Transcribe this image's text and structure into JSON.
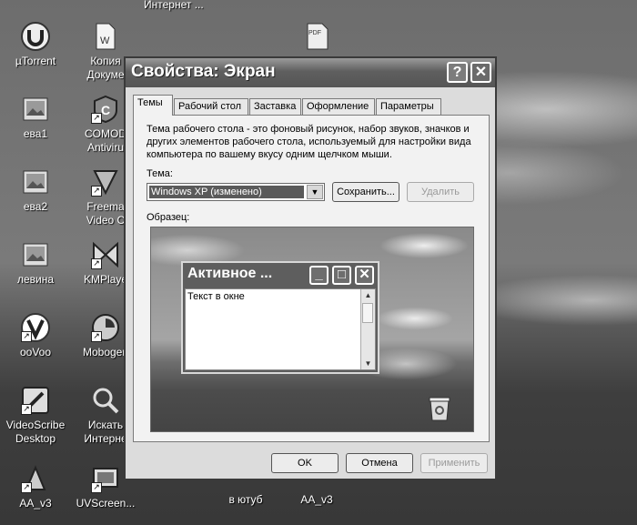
{
  "desktop": {
    "top_label": "Интернет ...",
    "icons": [
      {
        "label": "µTorrent"
      },
      {
        "label": "ева1"
      },
      {
        "label": "ева2"
      },
      {
        "label": "левина"
      },
      {
        "label": "ooVoo"
      },
      {
        "label": "VideoScribe"
      },
      {
        "label": "Desktop"
      },
      {
        "label": "AA_v3"
      },
      {
        "label": "Копия"
      },
      {
        "label": "Докуме"
      },
      {
        "label": "COMOD"
      },
      {
        "label": "Antiviru"
      },
      {
        "label": "Freema"
      },
      {
        "label": "Video C"
      },
      {
        "label": "KMPlaye"
      },
      {
        "label": "Mobogen"
      },
      {
        "label": "Искать"
      },
      {
        "label": "Интерне"
      },
      {
        "label": "UVScreen..."
      },
      {
        "label": "в ютуб"
      },
      {
        "label": "AA_v3"
      }
    ]
  },
  "dialog": {
    "title": "Свойства: Экран",
    "help_glyph": "?",
    "close_glyph": "✕",
    "tabs": [
      {
        "label": "Темы"
      },
      {
        "label": "Рабочий стол"
      },
      {
        "label": "Заставка"
      },
      {
        "label": "Оформление"
      },
      {
        "label": "Параметры"
      }
    ],
    "description": "Тема рабочего стола - это фоновый рисунок, набор звуков, значков и других элементов рабочего стола, используемый для настройки вида компьютера по вашему вкусу одним щелчком мыши.",
    "theme_label": "Тема:",
    "theme_value": "Windows XP (изменено)",
    "save_button": "Сохранить...",
    "delete_button": "Удалить",
    "sample_label": "Образец:",
    "preview": {
      "window_title": "Активное ...",
      "window_text": "Текст в окне",
      "min_glyph": "_",
      "max_glyph": "□",
      "close_glyph": "✕"
    },
    "ok_button": "OK",
    "cancel_button": "Отмена",
    "apply_button": "Применить"
  }
}
